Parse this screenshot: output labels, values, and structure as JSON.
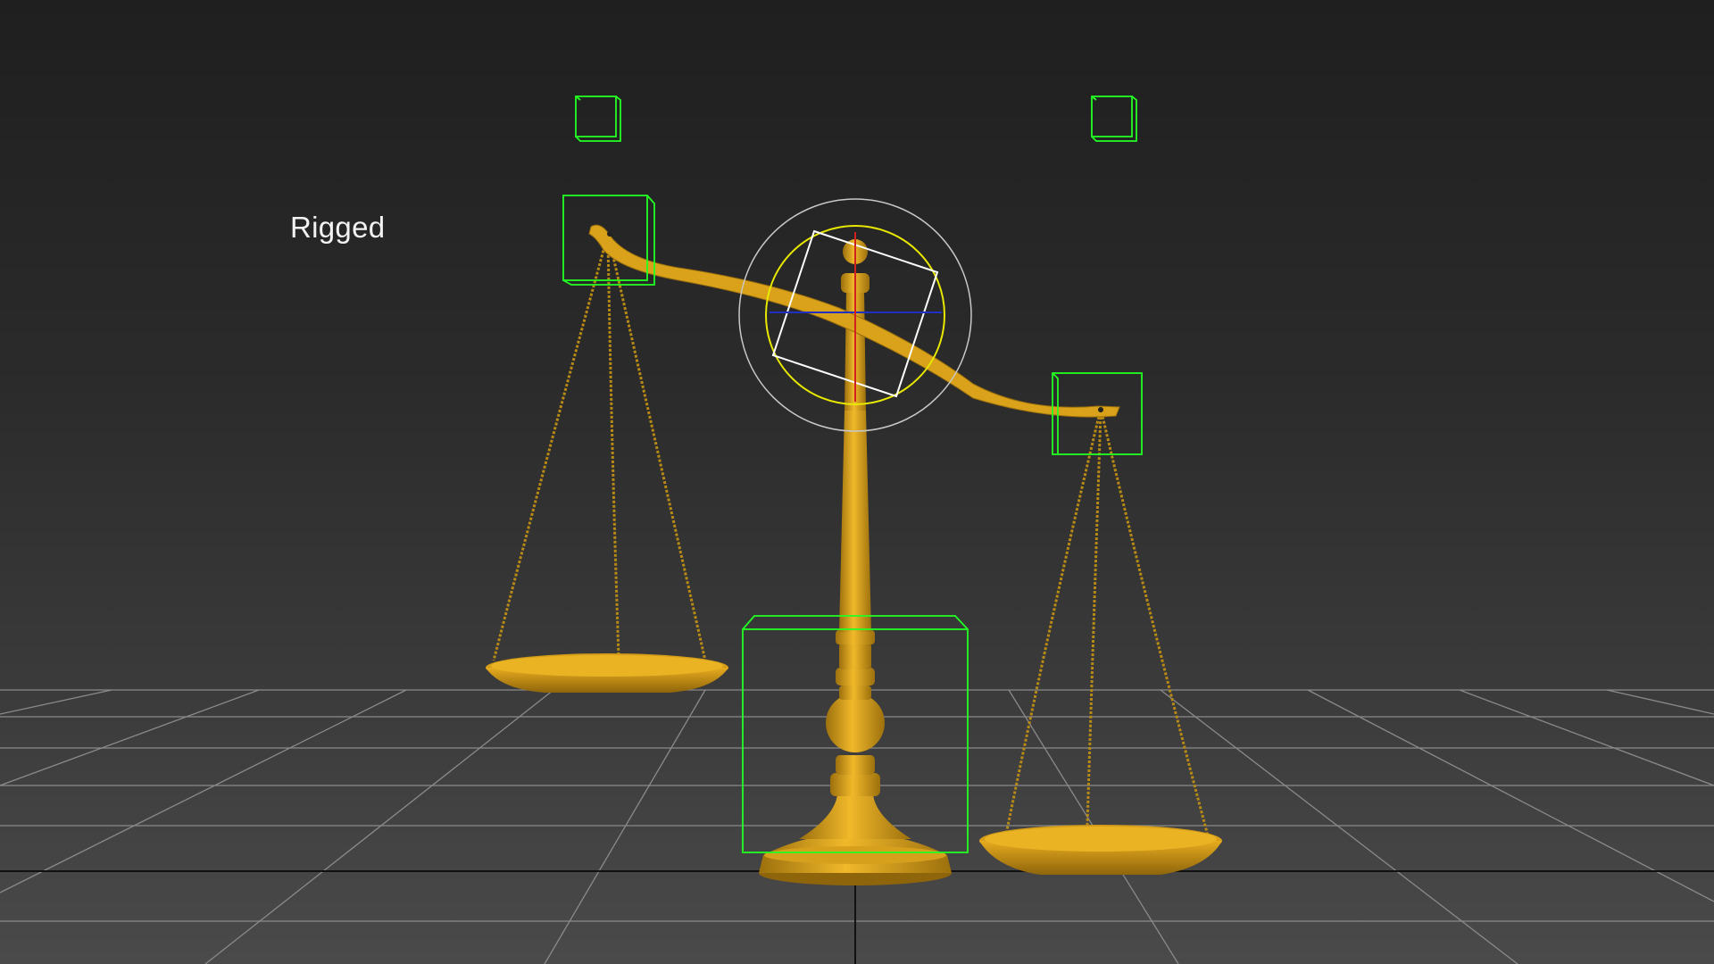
{
  "viewport": {
    "label": "Rigged"
  },
  "colors": {
    "background_top": "#1f1f1f",
    "background_bottom": "#4a4a4a",
    "grid_line": "#8a8a8a",
    "grid_axis": "#111111",
    "model_gold": "#d9a21a",
    "model_gold_dark": "#9c700d",
    "helper_green": "#22ff22",
    "gizmo_yellow": "#e8e800",
    "gizmo_gray": "#c8c8c8",
    "gizmo_white": "#ffffff",
    "axis_blue": "#2030c0",
    "axis_red": "#d02020"
  },
  "icons": [
    "rotate-gizmo-icon",
    "point-helper-icon"
  ]
}
